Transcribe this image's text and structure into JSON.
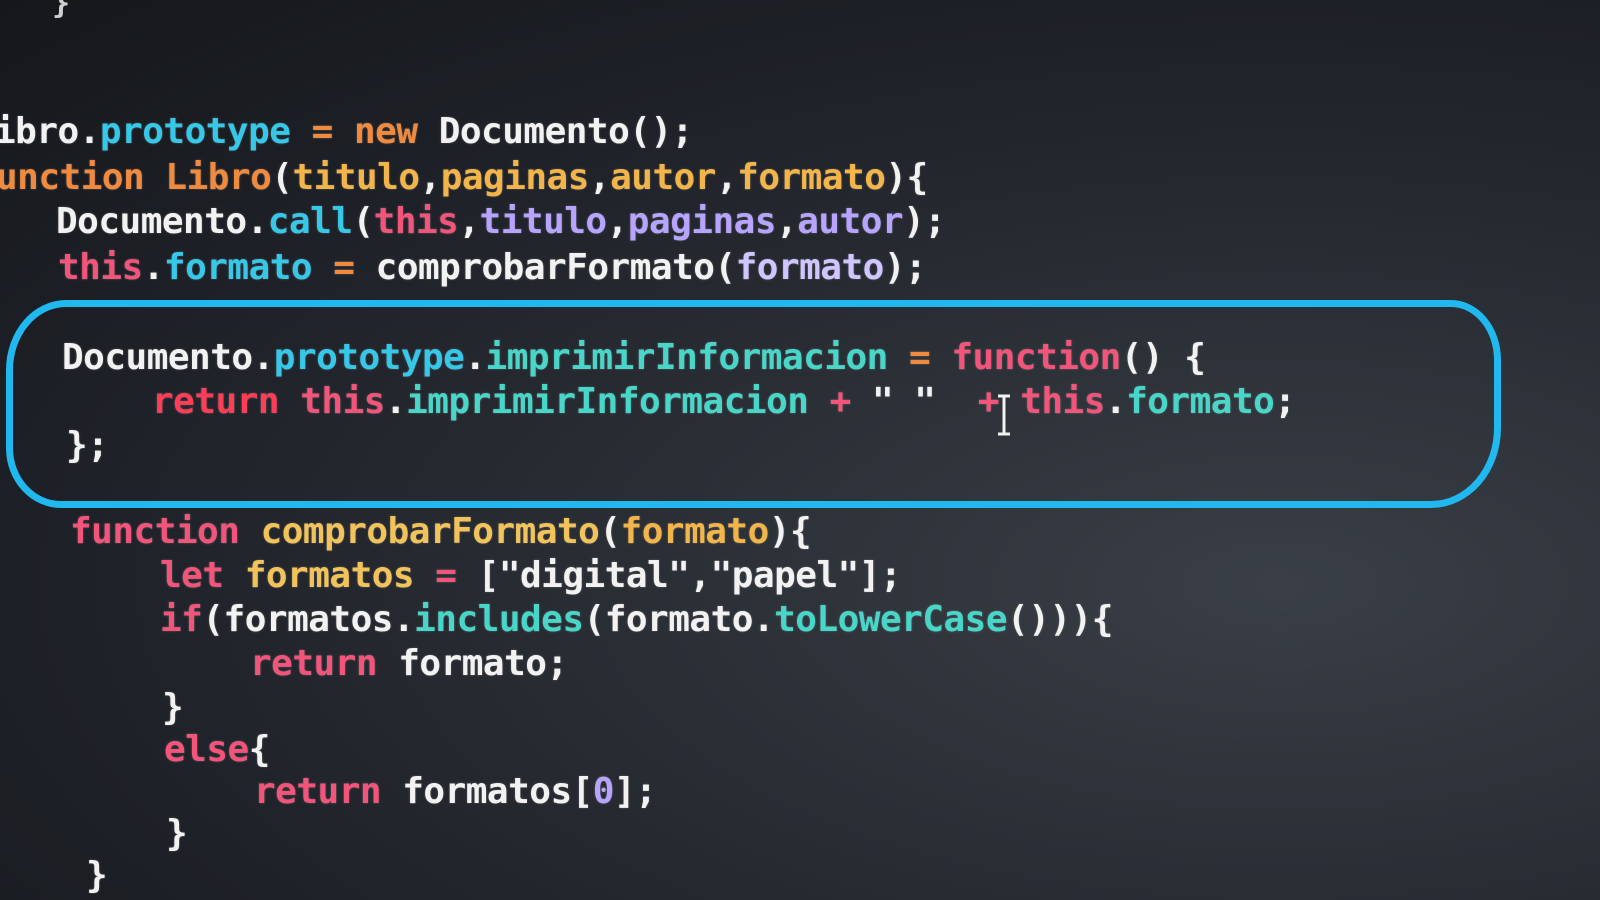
{
  "editor": {
    "partial_top_char": "}",
    "lines": [
      {
        "id": "line-1",
        "tokens": [
          {
            "text": "ibro",
            "cls": "t-white"
          },
          {
            "text": ".",
            "cls": "t-white"
          },
          {
            "text": "prototype",
            "cls": "t-cyan"
          },
          {
            "text": " = ",
            "cls": "t-orange"
          },
          {
            "text": "new",
            "cls": "t-orange"
          },
          {
            "text": " Documento();",
            "cls": "t-white"
          }
        ]
      },
      {
        "id": "line-2",
        "tokens": [
          {
            "text": "unction",
            "cls": "t-orange"
          },
          {
            "text": " Libro",
            "cls": "t-orange"
          },
          {
            "text": "(",
            "cls": "t-white"
          },
          {
            "text": "titulo",
            "cls": "t-amber"
          },
          {
            "text": ",",
            "cls": "t-white"
          },
          {
            "text": "paginas",
            "cls": "t-amber"
          },
          {
            "text": ",",
            "cls": "t-white"
          },
          {
            "text": "autor",
            "cls": "t-amber"
          },
          {
            "text": ",",
            "cls": "t-white"
          },
          {
            "text": "formato",
            "cls": "t-amber"
          },
          {
            "text": "){",
            "cls": "t-white"
          }
        ]
      },
      {
        "id": "line-3",
        "tokens": [
          {
            "text": "Documento",
            "cls": "t-white"
          },
          {
            "text": ".",
            "cls": "t-white"
          },
          {
            "text": "call",
            "cls": "t-cyan"
          },
          {
            "text": "(",
            "cls": "t-white"
          },
          {
            "text": "this",
            "cls": "t-pink"
          },
          {
            "text": ",",
            "cls": "t-white"
          },
          {
            "text": "titulo",
            "cls": "t-purple"
          },
          {
            "text": ",",
            "cls": "t-white"
          },
          {
            "text": "paginas",
            "cls": "t-purple"
          },
          {
            "text": ",",
            "cls": "t-white"
          },
          {
            "text": "autor",
            "cls": "t-purple"
          },
          {
            "text": ");",
            "cls": "t-white"
          }
        ]
      },
      {
        "id": "line-4",
        "tokens": [
          {
            "text": "this",
            "cls": "t-pink"
          },
          {
            "text": ".",
            "cls": "t-white"
          },
          {
            "text": "formato",
            "cls": "t-cyan"
          },
          {
            "text": " = ",
            "cls": "t-orange"
          },
          {
            "text": "comprobarFormato",
            "cls": "t-white"
          },
          {
            "text": "(",
            "cls": "t-white"
          },
          {
            "text": "formato",
            "cls": "t-lav"
          },
          {
            "text": ");",
            "cls": "t-white"
          }
        ]
      },
      {
        "id": "line-5",
        "tokens": [
          {
            "text": "Documento",
            "cls": "t-white"
          },
          {
            "text": ".",
            "cls": "t-white"
          },
          {
            "text": "prototype",
            "cls": "t-cyan"
          },
          {
            "text": ".",
            "cls": "t-white"
          },
          {
            "text": "imprimirInformacion",
            "cls": "t-teal"
          },
          {
            "text": " = ",
            "cls": "t-orange"
          },
          {
            "text": "function",
            "cls": "t-pink"
          },
          {
            "text": "() {",
            "cls": "t-white"
          }
        ]
      },
      {
        "id": "line-6",
        "tokens": [
          {
            "text": "return",
            "cls": "t-red"
          },
          {
            "text": " this",
            "cls": "t-pink"
          },
          {
            "text": ".",
            "cls": "t-white"
          },
          {
            "text": "imprimirInformacion",
            "cls": "t-teal"
          },
          {
            "text": " + ",
            "cls": "t-pink"
          },
          {
            "text": "\" \"",
            "cls": "t-white"
          },
          {
            "text": "  + ",
            "cls": "t-pink"
          },
          {
            "text": "this",
            "cls": "t-pink"
          },
          {
            "text": ".",
            "cls": "t-white"
          },
          {
            "text": "formato",
            "cls": "t-teal"
          },
          {
            "text": ";",
            "cls": "t-white"
          }
        ]
      },
      {
        "id": "line-7",
        "tokens": [
          {
            "text": "};",
            "cls": "t-white"
          }
        ]
      },
      {
        "id": "line-8",
        "tokens": [
          {
            "text": "function",
            "cls": "t-pink"
          },
          {
            "text": " comprobarFormato",
            "cls": "t-yellow"
          },
          {
            "text": "(",
            "cls": "t-white"
          },
          {
            "text": "formato",
            "cls": "t-amber"
          },
          {
            "text": "){",
            "cls": "t-white"
          }
        ]
      },
      {
        "id": "line-9",
        "tokens": [
          {
            "text": "let",
            "cls": "t-pink"
          },
          {
            "text": " formatos",
            "cls": "t-yellow"
          },
          {
            "text": " = ",
            "cls": "t-pink"
          },
          {
            "text": "[",
            "cls": "t-white"
          },
          {
            "text": "\"digital\"",
            "cls": "t-white"
          },
          {
            "text": ",",
            "cls": "t-white"
          },
          {
            "text": "\"papel\"",
            "cls": "t-white"
          },
          {
            "text": "];",
            "cls": "t-white"
          }
        ]
      },
      {
        "id": "line-10",
        "tokens": [
          {
            "text": "if",
            "cls": "t-pink"
          },
          {
            "text": "(",
            "cls": "t-white"
          },
          {
            "text": "formatos",
            "cls": "t-white"
          },
          {
            "text": ".",
            "cls": "t-white"
          },
          {
            "text": "includes",
            "cls": "t-teal"
          },
          {
            "text": "(",
            "cls": "t-white"
          },
          {
            "text": "formato",
            "cls": "t-white"
          },
          {
            "text": ".",
            "cls": "t-white"
          },
          {
            "text": "toLowerCase",
            "cls": "t-teal"
          },
          {
            "text": "())){",
            "cls": "t-white"
          }
        ]
      },
      {
        "id": "line-11",
        "tokens": [
          {
            "text": "return",
            "cls": "t-pink"
          },
          {
            "text": " formato;",
            "cls": "t-white"
          }
        ]
      },
      {
        "id": "line-12",
        "tokens": [
          {
            "text": "}",
            "cls": "t-white"
          }
        ]
      },
      {
        "id": "line-13",
        "tokens": [
          {
            "text": "else",
            "cls": "t-pink"
          },
          {
            "text": "{",
            "cls": "t-white"
          }
        ]
      },
      {
        "id": "line-14",
        "tokens": [
          {
            "text": "return",
            "cls": "t-pink"
          },
          {
            "text": " formatos[",
            "cls": "t-white"
          },
          {
            "text": "0",
            "cls": "t-purple"
          },
          {
            "text": "];",
            "cls": "t-white"
          }
        ]
      },
      {
        "id": "line-15",
        "tokens": [
          {
            "text": "}",
            "cls": "t-white"
          }
        ]
      },
      {
        "id": "line-16",
        "tokens": [
          {
            "text": "}",
            "cls": "t-white"
          }
        ]
      }
    ]
  },
  "annotation": {
    "ring_color": "#20b8ef"
  },
  "colors": {
    "background": "#1d2026",
    "highlight_ring": "#20b8ef"
  }
}
